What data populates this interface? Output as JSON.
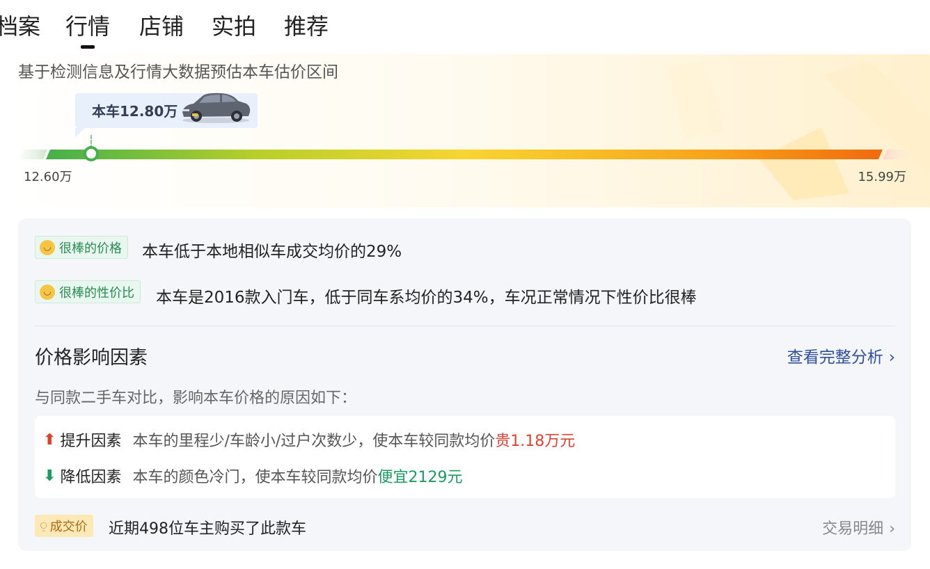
{
  "tabs": [
    {
      "label": "档案"
    },
    {
      "label": "行情",
      "active": true
    },
    {
      "label": "店铺"
    },
    {
      "label": "实拍"
    },
    {
      "label": "推荐"
    }
  ],
  "hero": {
    "subtitle": "基于检测信息及行情大数据预估本车估价区间",
    "current_price_label": "本车12.80万",
    "range_min": "12.60万",
    "range_max": "15.99万",
    "current_price_fraction": 0.06
  },
  "highlights": [
    {
      "badge": "很棒的价格",
      "text": "本车低于本地相似车成交均价的29%"
    },
    {
      "badge": "很棒的性价比",
      "text": "本车是2016款入门车，低于同车系均价的34%，车况正常情况下性价比很棒"
    }
  ],
  "factors_section": {
    "title": "价格影响因素",
    "link": "查看完整分析",
    "description": "与同款二手车对比，影响本车价格的原因如下：",
    "up": {
      "arrow": "⬆",
      "label": "提升因素",
      "text": "本车的里程少/车龄小/过户次数少，使本车较同款均价",
      "value": "贵1.18万元"
    },
    "down": {
      "arrow": "⬇",
      "label": "降低因素",
      "text": "本车的颜色冷门，使本车较同款均价",
      "value": "便宜2129元"
    }
  },
  "deal": {
    "badge": "成交价",
    "text": "近期498位车主购买了此款车",
    "link": "交易明细"
  },
  "icons": {
    "chevron": "›",
    "emoji": "◡"
  },
  "colors": {
    "bar_start": "#45b04c",
    "bar_mid": "#f7d531",
    "bar_end": "#f06a0e",
    "up_red": "#e0412e",
    "down_green": "#1a9b5f",
    "link_blue": "#2f4f9e"
  }
}
